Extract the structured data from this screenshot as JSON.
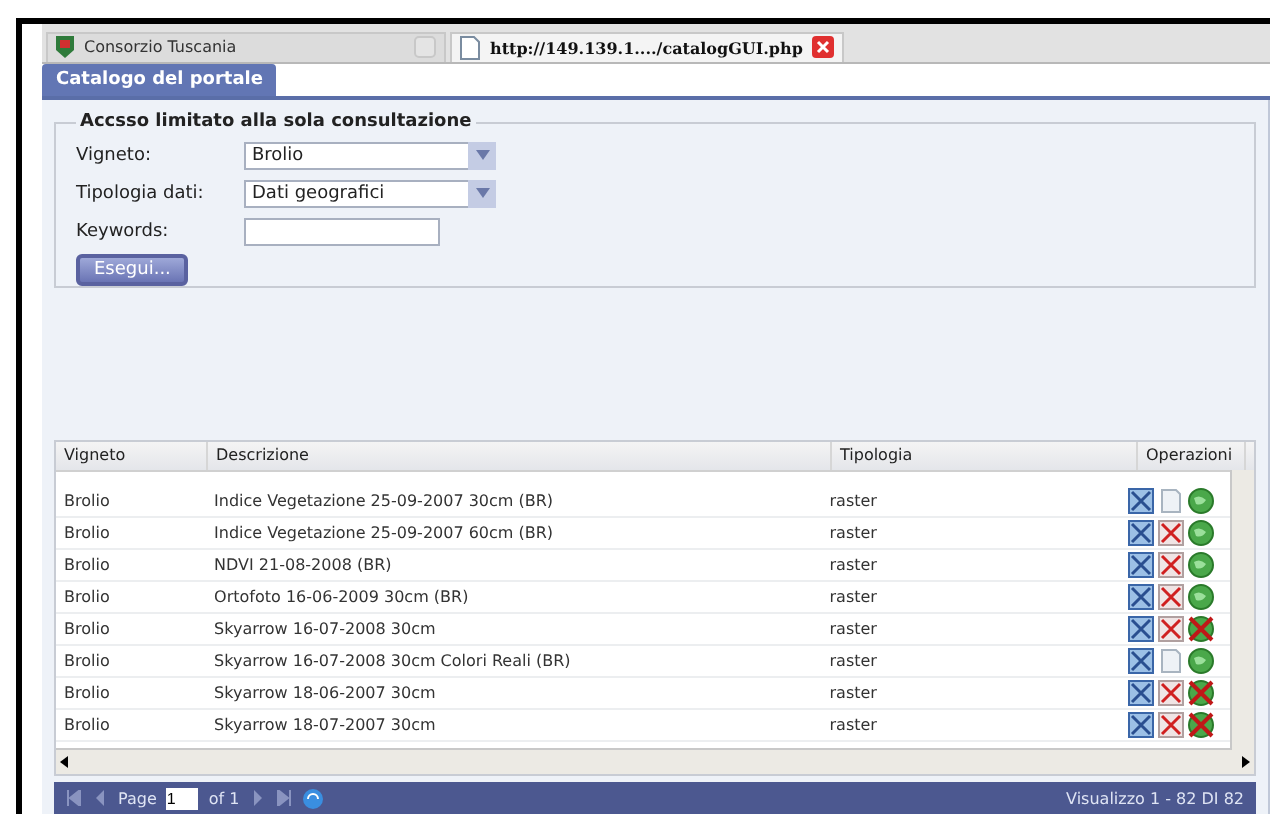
{
  "browser_tabs": [
    {
      "label": "Consorzio Tuscania",
      "selected": false
    },
    {
      "label": "http://149.139.1..../catalogGUI.php",
      "selected": true
    }
  ],
  "app_tab": {
    "label": "Catalogo del portale"
  },
  "form": {
    "legend": "Accsso limitato alla sola consultazione",
    "fields": [
      {
        "kind": "select",
        "label": "Vigneto:",
        "value": "Brolio"
      },
      {
        "kind": "select",
        "label": "Tipologia dati:",
        "value": "Dati geografici"
      },
      {
        "kind": "text",
        "label": "Keywords:"
      }
    ],
    "button": "Esegui..."
  },
  "table": {
    "columns": [
      "Vigneto",
      "Descrizione",
      "Tipologia",
      "Operazioni"
    ],
    "rows": [
      {
        "cells": [
          "Brolio",
          "Indice Vegetazione 25-09-2007 30cm (BR)",
          "raster"
        ],
        "ops": [
          {
            "kind": "map"
          },
          {
            "kind": "doc"
          },
          {
            "kind": "globe"
          }
        ]
      },
      {
        "cells": [
          "Brolio",
          "Indice Vegetazione 25-09-2007 60cm (BR)",
          "raster"
        ],
        "ops": [
          {
            "kind": "map"
          },
          {
            "kind": "cross"
          },
          {
            "kind": "globe"
          }
        ]
      },
      {
        "cells": [
          "Brolio",
          "NDVI 21-08-2008 (BR)",
          "raster"
        ],
        "ops": [
          {
            "kind": "map"
          },
          {
            "kind": "cross"
          },
          {
            "kind": "globe"
          }
        ]
      },
      {
        "cells": [
          "Brolio",
          "Ortofoto 16-06-2009 30cm (BR)",
          "raster"
        ],
        "ops": [
          {
            "kind": "map"
          },
          {
            "kind": "cross"
          },
          {
            "kind": "globe"
          }
        ]
      },
      {
        "cells": [
          "Brolio",
          "Skyarrow 16-07-2008 30cm",
          "raster"
        ],
        "ops": [
          {
            "kind": "map"
          },
          {
            "kind": "cross"
          },
          {
            "kind": "nogo"
          }
        ]
      },
      {
        "cells": [
          "Brolio",
          "Skyarrow 16-07-2008 30cm Colori Reali (BR)",
          "raster"
        ],
        "ops": [
          {
            "kind": "map"
          },
          {
            "kind": "doc"
          },
          {
            "kind": "globe"
          }
        ]
      },
      {
        "cells": [
          "Brolio",
          "Skyarrow 18-06-2007 30cm",
          "raster"
        ],
        "ops": [
          {
            "kind": "map"
          },
          {
            "kind": "cross"
          },
          {
            "kind": "nogo"
          }
        ]
      },
      {
        "cells": [
          "Brolio",
          "Skyarrow 18-07-2007 30cm",
          "raster"
        ],
        "ops": [
          {
            "kind": "map"
          },
          {
            "kind": "cross"
          },
          {
            "kind": "nogo"
          }
        ]
      }
    ]
  },
  "pager": {
    "page_label": "Page",
    "page_value": "1",
    "of_label": "of 1",
    "summary": "Visualizzo 1 - 82 DI 82"
  }
}
